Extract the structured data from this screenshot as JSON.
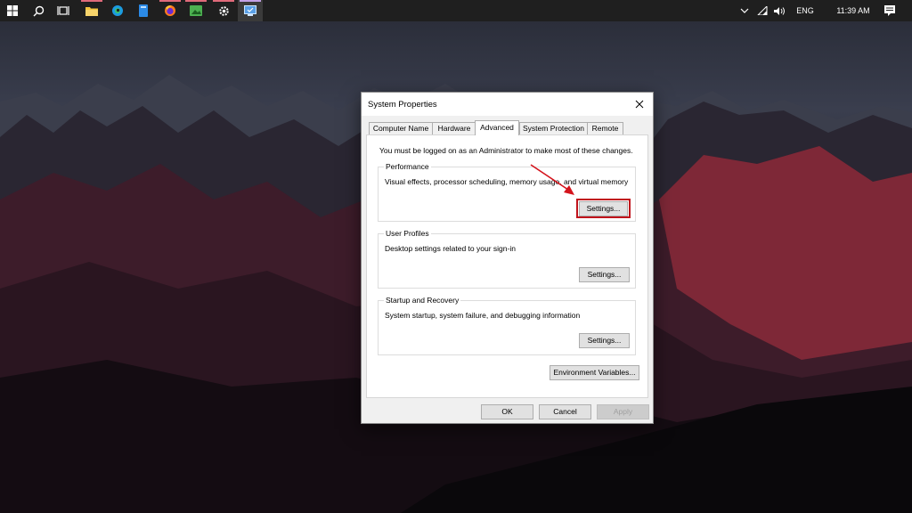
{
  "taskbar": {
    "icons": [
      "windows-start-icon",
      "search-icon",
      "task-view-icon",
      "file-explorer-icon",
      "edge-icon",
      "app-icon",
      "firefox-icon",
      "photos-icon",
      "settings-gear-icon",
      "system-properties-icon"
    ],
    "tray": {
      "language": "ENG",
      "time": "11:39 AM"
    },
    "accent": "#e06a7a"
  },
  "dialog": {
    "title": "System Properties",
    "tabs": [
      {
        "label": "Computer Name"
      },
      {
        "label": "Hardware"
      },
      {
        "label": "Advanced",
        "selected": true
      },
      {
        "label": "System Protection"
      },
      {
        "label": "Remote"
      }
    ],
    "admin_note": "You must be logged on as an Administrator to make most of these changes.",
    "performance": {
      "title": "Performance",
      "desc": "Visual effects, processor scheduling, memory usage, and virtual memory",
      "button": "Settings..."
    },
    "user_profiles": {
      "title": "User Profiles",
      "desc": "Desktop settings related to your sign-in",
      "button": "Settings..."
    },
    "startup_recovery": {
      "title": "Startup and Recovery",
      "desc": "System startup, system failure, and debugging information",
      "button": "Settings..."
    },
    "env_button": "Environment Variables...",
    "ok": "OK",
    "cancel": "Cancel",
    "apply": "Apply",
    "highlight_color": "#c0141c"
  }
}
